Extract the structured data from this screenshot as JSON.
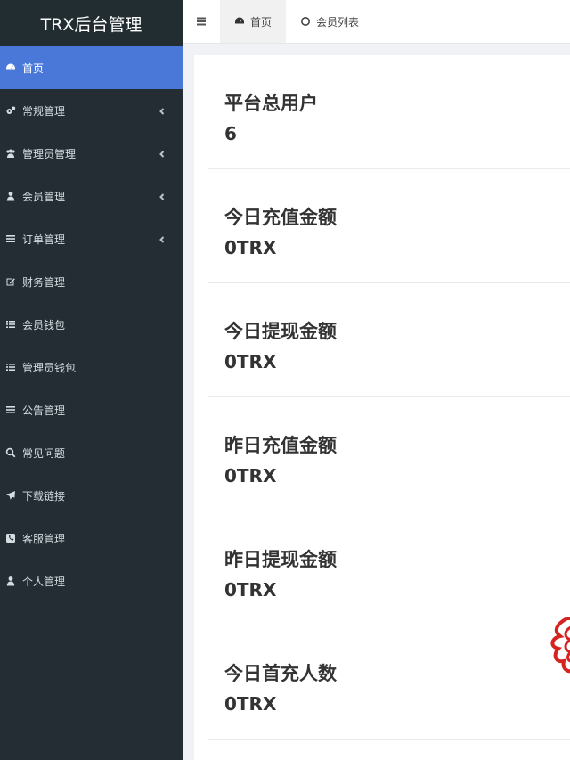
{
  "brand": {
    "title": "TRX后台管理"
  },
  "sidebar": {
    "items": [
      {
        "label": "首页",
        "icon": "dashboard-icon",
        "active": true,
        "has_sub": false
      },
      {
        "label": "常规管理",
        "icon": "cogs-icon",
        "active": false,
        "has_sub": true
      },
      {
        "label": "管理员管理",
        "icon": "users-icon",
        "active": false,
        "has_sub": true
      },
      {
        "label": "会员管理",
        "icon": "user-icon",
        "active": false,
        "has_sub": true
      },
      {
        "label": "订单管理",
        "icon": "bars-icon",
        "active": false,
        "has_sub": true
      },
      {
        "label": "财务管理",
        "icon": "edit-icon",
        "active": false,
        "has_sub": false
      },
      {
        "label": "会员钱包",
        "icon": "list-icon",
        "active": false,
        "has_sub": false
      },
      {
        "label": "管理员钱包",
        "icon": "list-icon",
        "active": false,
        "has_sub": false
      },
      {
        "label": "公告管理",
        "icon": "bars-icon",
        "active": false,
        "has_sub": false
      },
      {
        "label": "常见问题",
        "icon": "search-icon",
        "active": false,
        "has_sub": false
      },
      {
        "label": "下载链接",
        "icon": "plane-icon",
        "active": false,
        "has_sub": false
      },
      {
        "label": "客服管理",
        "icon": "phone-icon",
        "active": false,
        "has_sub": false
      },
      {
        "label": "个人管理",
        "icon": "user-icon",
        "active": false,
        "has_sub": false
      }
    ]
  },
  "tabs": [
    {
      "label": "首页",
      "icon": "dashboard-icon",
      "active": true
    },
    {
      "label": "会员列表",
      "icon": "circle-icon",
      "active": false
    }
  ],
  "stats": [
    {
      "label": "平台总用户",
      "value": "6"
    },
    {
      "label": "今日充值金额",
      "value": "0TRX"
    },
    {
      "label": "今日提现金额",
      "value": "0TRX"
    },
    {
      "label": "昨日充值金额",
      "value": "0TRX"
    },
    {
      "label": "昨日提现金额",
      "value": "0TRX"
    },
    {
      "label": "今日首充人数",
      "value": "0TRX"
    }
  ],
  "colors": {
    "sidebar_bg": "#232d33",
    "active_bg": "#4a78d8",
    "watermark": "#d6231f"
  }
}
